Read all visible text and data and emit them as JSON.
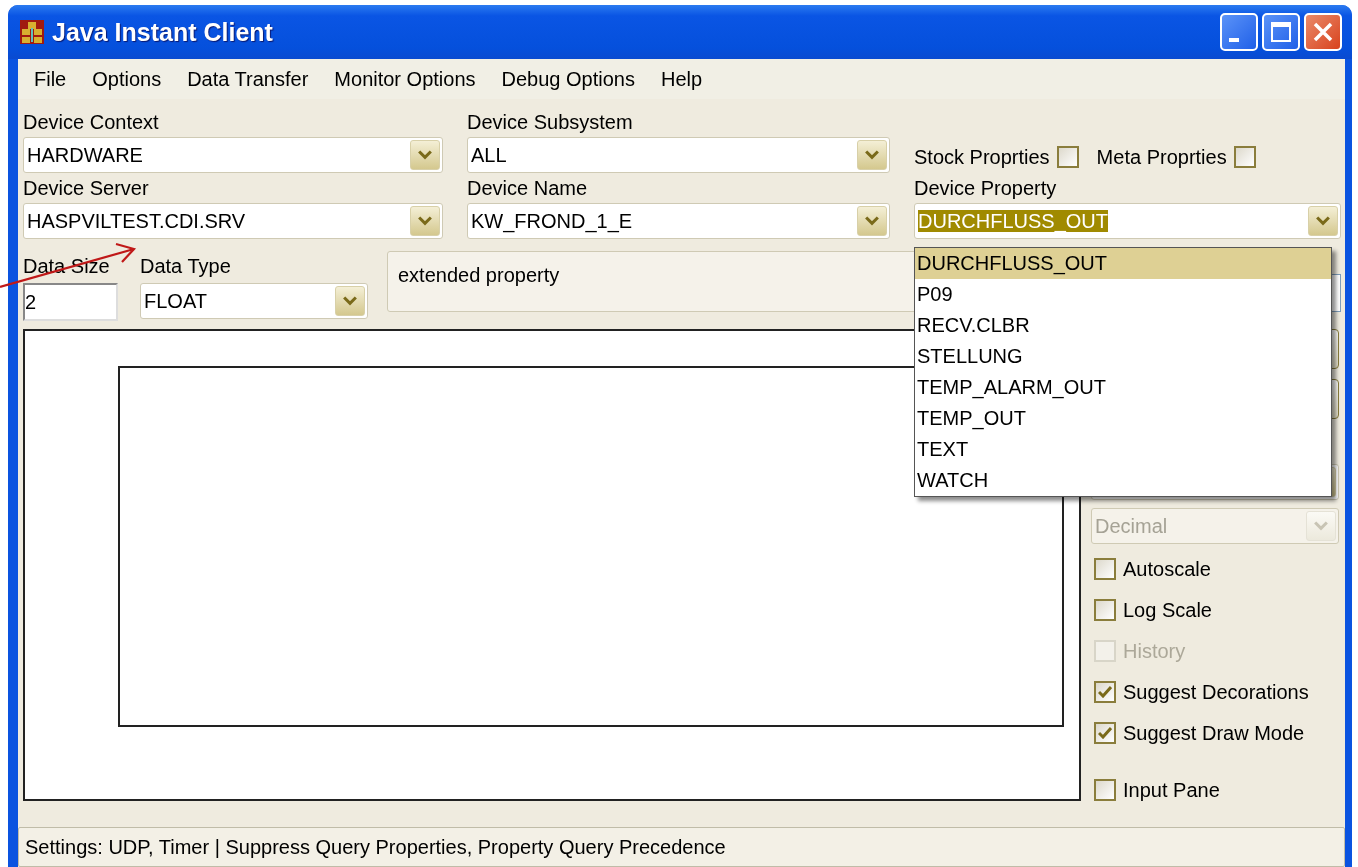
{
  "window": {
    "title": "Java Instant Client"
  },
  "menu": [
    "File",
    "Options",
    "Data Transfer",
    "Monitor Options",
    "Debug Options",
    "Help"
  ],
  "selectors": [
    {
      "label": "Device Context",
      "value": "HARDWARE"
    },
    {
      "label": "Device Subsystem",
      "value": "ALL"
    },
    {
      "label": "Device Server",
      "value": "HASPVILTEST.CDI.SRV"
    },
    {
      "label": "Device Name",
      "value": "KW_FROND_1_E"
    }
  ],
  "property_checks": [
    {
      "label": "Stock Proprties",
      "checked": false
    },
    {
      "label": "Meta Proprties",
      "checked": false
    }
  ],
  "device_property": {
    "label": "Device Property",
    "value": "DURCHFLUSS_OUT",
    "open": true,
    "items": [
      {
        "label": "DURCHFLUSS_OUT",
        "selected": true
      },
      {
        "label": "P09",
        "selected": false
      },
      {
        "label": "RECV.CLBR",
        "selected": false
      },
      {
        "label": "STELLUNG",
        "selected": false
      },
      {
        "label": "TEMP_ALARM_OUT",
        "selected": false
      },
      {
        "label": "TEMP_OUT",
        "selected": false
      },
      {
        "label": "TEXT",
        "selected": false
      },
      {
        "label": "WATCH",
        "selected": false
      }
    ]
  },
  "data_size": {
    "label": "Data Size",
    "value": "2"
  },
  "data_type": {
    "label": "Data Type",
    "value": "FLOAT"
  },
  "extended_property": "extended property",
  "format": {
    "value": "Decimal",
    "disabled": true
  },
  "options": [
    {
      "label": "Autoscale",
      "checked": false,
      "disabled": false
    },
    {
      "label": "Log Scale",
      "checked": false,
      "disabled": false
    },
    {
      "label": "History",
      "checked": false,
      "disabled": true
    },
    {
      "label": "Suggest Decorations",
      "checked": true,
      "disabled": false
    },
    {
      "label": "Suggest Draw Mode",
      "checked": true,
      "disabled": false
    },
    {
      "label": "Input Pane",
      "checked": false,
      "disabled": false
    }
  ],
  "status_bar": "Settings: UDP, Timer | Suppress Query Properties, Property Query Precedence"
}
